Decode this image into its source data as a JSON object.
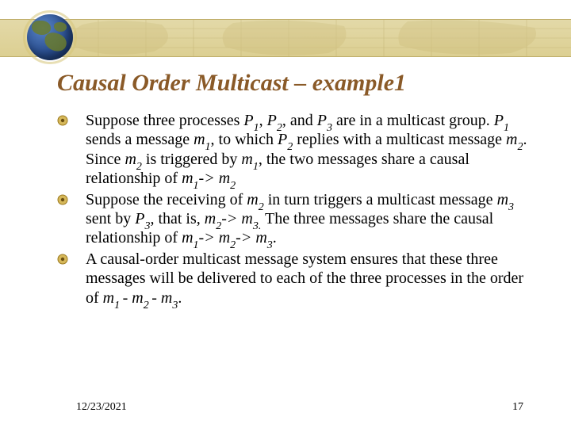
{
  "title": "Causal Order Multicast – example1",
  "bullets": {
    "b1": {
      "pre": "Suppose three processes ",
      "p1": "P",
      "p1s": "1",
      "c1": ", ",
      "p2": "P",
      "p2s": "2",
      "c2": ", and ",
      "p3": "P",
      "p3s": "3",
      "t1": " are in a multicast group. ",
      "p1b": "P",
      "p1bs": "1",
      "t2": " sends a message ",
      "m1": "m",
      "m1s": "1",
      "t3": ", to which ",
      "p2b": "P",
      "p2bs": "2",
      "t4": " replies with a multicast message ",
      "m2": "m",
      "m2s": "2",
      "t5": ".  Since ",
      "m2b": "m",
      "m2bs": "2",
      "t6": " is triggered by ",
      "m1b": "m",
      "m1bs": "1",
      "t7": ", the two messages share a causal relationship of ",
      "m1c": "m",
      "m1cs": "1",
      "arrow1": "-> ",
      "m2c": "m",
      "m2cs": "2"
    },
    "b2": {
      "pre": "Suppose the receiving of ",
      "m2": "m",
      "m2s": "2",
      "t1": " in turn triggers a multicast message ",
      "m3": "m",
      "m3s": "3",
      "t2": " sent by ",
      "p3": "P",
      "p3s": "3",
      "t3": ", that is, ",
      "m2b": "m",
      "m2bs": "2",
      "arrow1": "-> ",
      "m3b": "m",
      "m3bs": "3.",
      "t4": " The three messages share the causal relationship of  ",
      "m1": "m",
      "m1s": "1",
      "arrow2": "-> ",
      "m2c": "m",
      "m2cs": "2",
      "arrow3": "-> ",
      "m3c": "m",
      "m3cs": "3",
      "tail": "."
    },
    "b3": {
      "pre": "A causal-order multicast message system ensures that these three messages will be delivered to each of the three processes in the order of ",
      "m1": "m",
      "m1s": "1 ",
      "d1": "- ",
      "m2": "m",
      "m2s": "2 ",
      "d2": "- ",
      "m3": "m",
      "m3s": "3",
      "tail": "."
    }
  },
  "footer": {
    "date": "12/23/2021",
    "page": "17"
  }
}
